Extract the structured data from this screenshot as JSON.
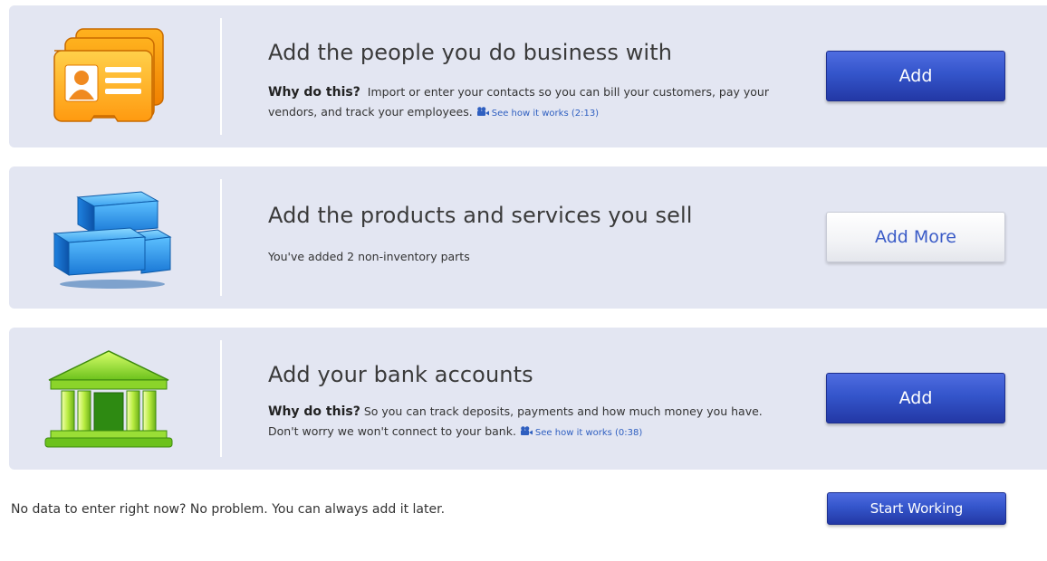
{
  "cards": [
    {
      "icon": "contact-cards-icon",
      "title": "Add the people you do business with",
      "why_label": "Why do this?",
      "description": "Import or enter your contacts so you can bill your customers, pay your vendors, and track your employees.",
      "video_link": "See how it works (2:13)",
      "button_label": "Add",
      "button_style": "primary"
    },
    {
      "icon": "boxes-icon",
      "title": "Add the products and services you sell",
      "status_text": "You've added  2 non-inventory parts",
      "button_label": "Add More",
      "button_style": "secondary"
    },
    {
      "icon": "bank-icon",
      "title": "Add your bank accounts",
      "why_label": "Why do this?",
      "description": "So you can track deposits, payments and how much money you have. Don't worry we won't connect to your bank.",
      "video_link": "See how it works (0:38)",
      "button_label": "Add",
      "button_style": "primary"
    }
  ],
  "footer": {
    "text": "No data to enter right now? No problem. You can always add it later.",
    "button_label": "Start Working"
  },
  "colors": {
    "card_background": "#e3e6f2",
    "primary_button": "#3455cb",
    "link": "#2f5fc0",
    "secondary_button_text": "#3a5bc7"
  }
}
